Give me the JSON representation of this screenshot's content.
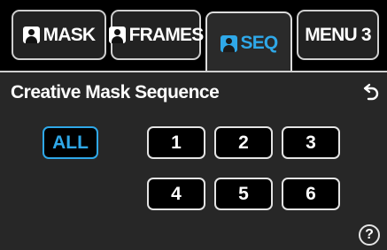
{
  "tabs": [
    {
      "label": "MASK",
      "icon": "person-icon",
      "active": false
    },
    {
      "label": "FRAMES",
      "icon": "person-icon",
      "active": false
    },
    {
      "label": "SEQ",
      "icon": "person-icon",
      "active": true
    },
    {
      "label": "MENU 3",
      "active": false
    }
  ],
  "screen": {
    "title": "Creative Mask Sequence",
    "back_icon": "return-arrow-icon",
    "help_label": "?"
  },
  "sequence_buttons": {
    "all": "ALL",
    "numbers": [
      "1",
      "2",
      "3",
      "4",
      "5",
      "6"
    ]
  },
  "colors": {
    "accent": "#2fa8e8",
    "panel_bg": "#272727",
    "tab_bg": "#222222",
    "border": "#cfcfcf"
  }
}
